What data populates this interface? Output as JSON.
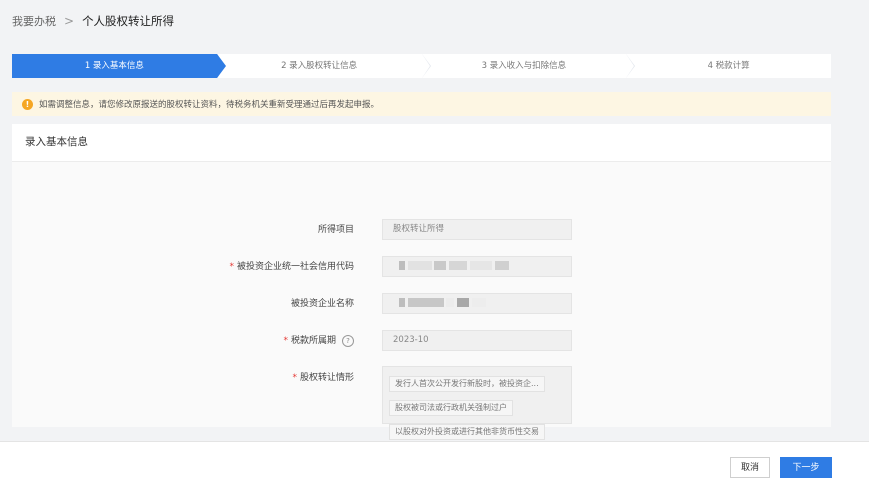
{
  "breadcrumb": {
    "parent": "我要办税",
    "separator": ">",
    "current": "个人股权转让所得"
  },
  "steps": [
    {
      "label": "1 录入基本信息"
    },
    {
      "label": "2 录入股权转让信息"
    },
    {
      "label": "3 录入收入与扣除信息"
    },
    {
      "label": "4 税款计算"
    }
  ],
  "notice": {
    "icon": "warning-icon",
    "text": "如需调整信息，请您修改原报送的股权转让资料，待税务机关重新受理通过后再发起申报。"
  },
  "form": {
    "title": "录入基本信息",
    "fields": {
      "income_item": {
        "label": "所得项目",
        "value": "股权转让所得"
      },
      "credit_code": {
        "label": "被投资企业统一社会信用代码",
        "required": "*"
      },
      "company_name": {
        "label": "被投资企业名称"
      },
      "tax_period": {
        "label": "税款所属期",
        "required": "*",
        "help": "?",
        "value": "2023-10"
      },
      "transfer_situation": {
        "label": "股权转让情形",
        "required": "*",
        "options": [
          "发行人首次公开发行新股时，被投资企...",
          "股权被司法或行政机关强制过户",
          "以股权对外投资或进行其他非货币性交易"
        ]
      }
    }
  },
  "footer": {
    "cancel_label": "取消",
    "next_label": "下一步"
  },
  "colors": {
    "primary": "#2f7ce4",
    "notice_bg": "#fdf6e3",
    "warn": "#f5a623",
    "required": "#e53935"
  }
}
